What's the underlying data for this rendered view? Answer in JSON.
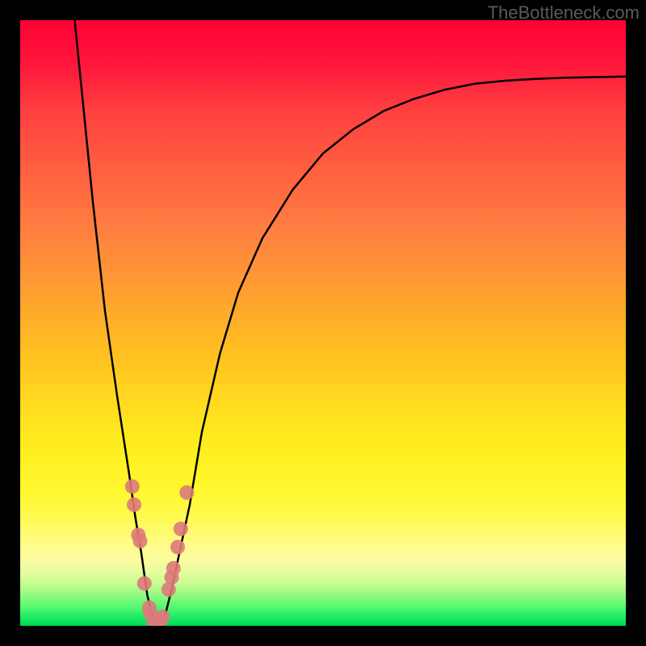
{
  "watermark": "TheBottleneck.com",
  "chart_data": {
    "type": "line",
    "title": "",
    "xlabel": "",
    "ylabel": "",
    "xlim": [
      0,
      100
    ],
    "ylim": [
      0,
      100
    ],
    "series": [
      {
        "name": "curve",
        "x": [
          9,
          10,
          12,
          14,
          16,
          18,
          19,
          20,
          21,
          22,
          23,
          24,
          25,
          28,
          30,
          33,
          36,
          40,
          45,
          50,
          55,
          60,
          65,
          70,
          75,
          80,
          85,
          90,
          95,
          100
        ],
        "y": [
          100,
          90,
          70,
          52,
          38,
          25,
          18,
          12,
          5,
          1,
          0.5,
          2,
          6,
          20,
          32,
          45,
          55,
          64,
          72,
          78,
          82,
          85,
          87,
          88.5,
          89.5,
          90,
          90.3,
          90.5,
          90.6,
          90.7
        ]
      }
    ],
    "dots": {
      "name": "data-points",
      "x": [
        18.5,
        18.8,
        19.5,
        19.8,
        20.5,
        21.3,
        21.5,
        22.0,
        22.8,
        23.2,
        23.5,
        24.5,
        25.0,
        25.3,
        26.0,
        26.5,
        27.5
      ],
      "y": [
        23,
        20,
        15,
        14,
        7,
        3,
        2,
        0.5,
        0.8,
        1.0,
        1.5,
        6,
        8,
        9.5,
        13,
        16,
        22
      ]
    }
  },
  "colors": {
    "dot_fill": "#dd7a7a",
    "curve_stroke": "#000000",
    "background_black": "#000000",
    "watermark_gray": "#5a5a5a"
  }
}
